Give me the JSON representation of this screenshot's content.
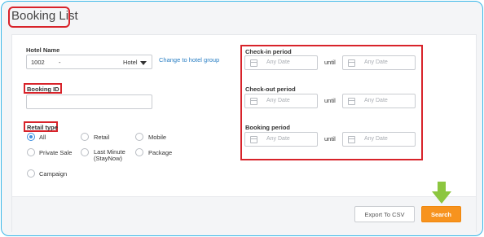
{
  "header": {
    "title": "Booking List"
  },
  "hotel": {
    "label": "Hotel Name",
    "code": "1002",
    "separator": "-",
    "value": "Hotel",
    "change_link": "Change to hotel group"
  },
  "booking_id": {
    "label": "Booking ID",
    "value": ""
  },
  "retail_type": {
    "label": "Retail type",
    "options": [
      {
        "label": "All",
        "checked": true
      },
      {
        "label": "Retail",
        "checked": false
      },
      {
        "label": "Mobile",
        "checked": false
      },
      {
        "label": "Private Sale",
        "checked": false
      },
      {
        "label": "Last Minute",
        "label2": "(StayNow)",
        "checked": false
      },
      {
        "label": "Package",
        "checked": false
      },
      {
        "label": "Campaign",
        "checked": false
      }
    ]
  },
  "periods": [
    {
      "label": "Check-in period",
      "from_placeholder": "Any Date",
      "until": "until",
      "to_placeholder": "Any Date"
    },
    {
      "label": "Check-out period",
      "from_placeholder": "Any Date",
      "until": "until",
      "to_placeholder": "Any Date"
    },
    {
      "label": "Booking period",
      "from_placeholder": "Any Date",
      "until": "until",
      "to_placeholder": "Any Date"
    }
  ],
  "actions": {
    "export_label": "Export To CSV",
    "search_label": "Search"
  },
  "colors": {
    "accent": "#f7931e",
    "highlight": "#d8232a",
    "arrow": "#8cc63f",
    "frame": "#39b7e8"
  }
}
